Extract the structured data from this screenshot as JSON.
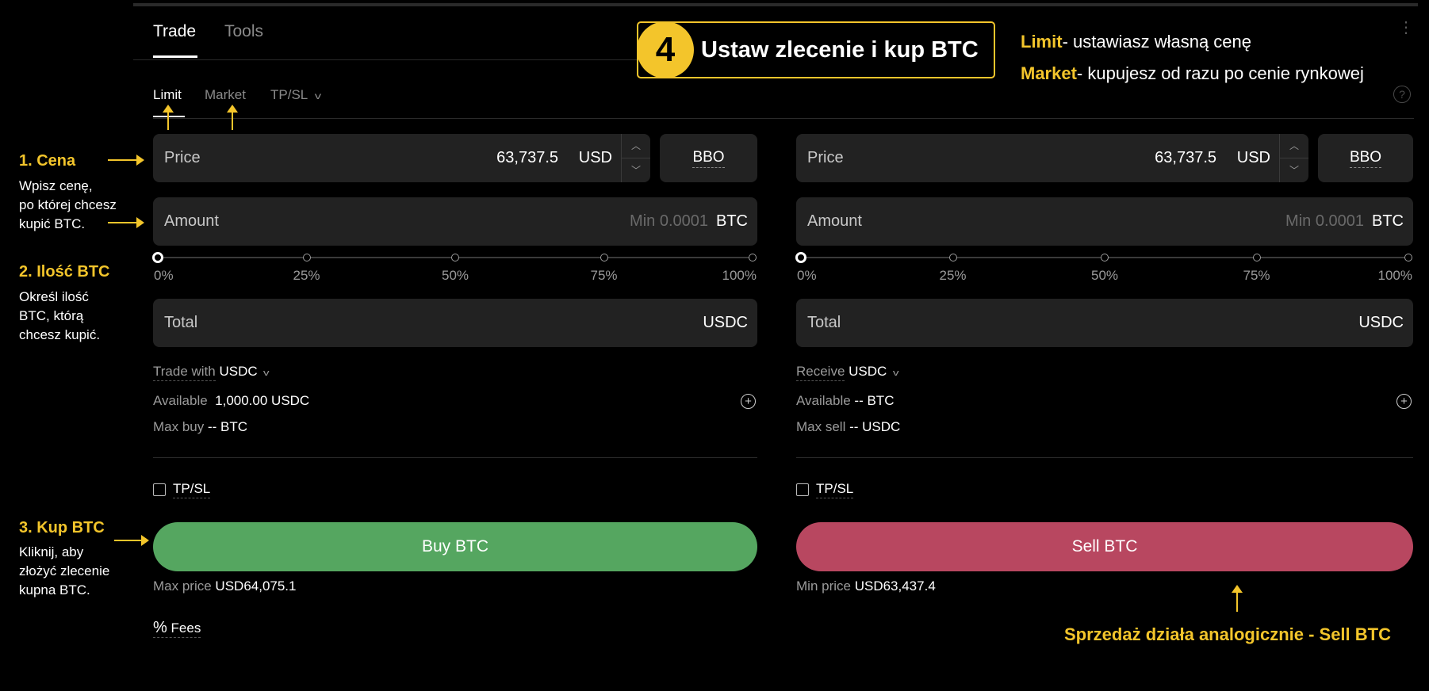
{
  "colors": {
    "accent": "#f3c52b",
    "buy": "#55a660",
    "sell": "#b84760"
  },
  "tabs": {
    "trade": "Trade",
    "tools": "Tools"
  },
  "callout": {
    "step": "4",
    "title": "Ustaw zlecenie i kup BTC"
  },
  "legend": {
    "limit_key": "Limit",
    "limit_text": "- ustawiasz własną cenę",
    "market_key": "Market",
    "market_text": "- kupujesz od razu po cenie rynkowej"
  },
  "order_tabs": {
    "limit": "Limit",
    "market": "Market",
    "tpsl": "TP/SL"
  },
  "buy": {
    "price_label": "Price",
    "price_value": "63,737.5",
    "price_currency": "USD",
    "bbo": "BBO",
    "amount_label": "Amount",
    "amount_placeholder": "Min 0.0001",
    "amount_currency": "BTC",
    "slider_pct": 0,
    "slider_labels": [
      "0%",
      "25%",
      "50%",
      "75%",
      "100%"
    ],
    "total_label": "Total",
    "total_currency": "USDC",
    "trade_with_label": "Trade with",
    "trade_with_value": "USDC",
    "available_label": "Available",
    "available_value": "1,000.00 USDC",
    "max_label": "Max buy",
    "max_value": "-- BTC",
    "tpsl_label": "TP/SL",
    "button": "Buy BTC",
    "limit_price_label": "Max price",
    "limit_price_value": "USD64,075.1",
    "fees_label": "Fees"
  },
  "sell": {
    "price_label": "Price",
    "price_value": "63,737.5",
    "price_currency": "USD",
    "bbo": "BBO",
    "amount_label": "Amount",
    "amount_placeholder": "Min 0.0001",
    "amount_currency": "BTC",
    "slider_pct": 0,
    "slider_labels": [
      "0%",
      "25%",
      "50%",
      "75%",
      "100%"
    ],
    "total_label": "Total",
    "total_currency": "USDC",
    "receive_label": "Receive",
    "receive_value": "USDC",
    "available_label": "Available",
    "available_value": "-- BTC",
    "max_label": "Max sell",
    "max_value": "-- USDC",
    "tpsl_label": "TP/SL",
    "button": "Sell BTC",
    "limit_price_label": "Min price",
    "limit_price_value": "USD63,437.4"
  },
  "annotations": {
    "step1_title": "1. Cena",
    "step1_text": [
      "Wpisz cenę,",
      "po której chcesz",
      "kupić BTC."
    ],
    "step2_title": "2. Ilość BTC",
    "step2_text": [
      "Określ ilość",
      "BTC, którą",
      "chcesz kupić."
    ],
    "step3_title": "3. Kup BTC",
    "step3_text": [
      "Kliknij, aby",
      "złożyć zlecenie",
      "kupna BTC."
    ],
    "sell_note": "Sprzedaż działa analogicznie - Sell BTC"
  }
}
